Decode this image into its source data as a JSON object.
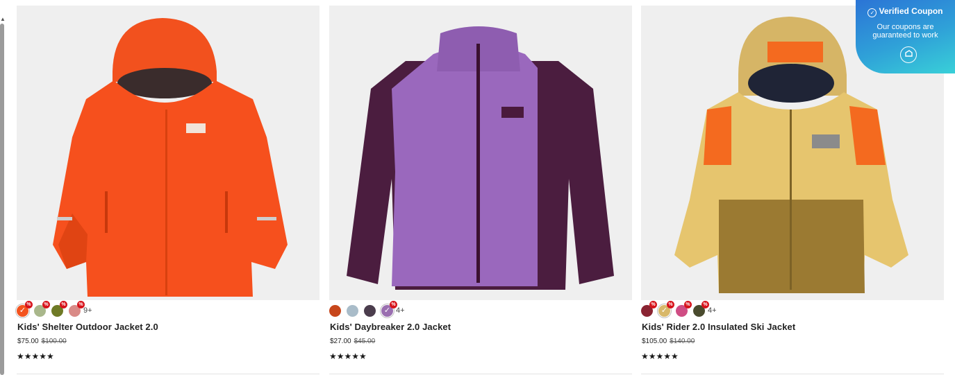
{
  "products": [
    {
      "name": "Kids' Shelter Outdoor Jacket 2.0",
      "price": "$75.00",
      "was_price": "$100.00",
      "rating": "★★★★★",
      "more_colors": "9+",
      "image_icon": "orange-rain-jacket-image",
      "swatches": [
        "#f3531e",
        "#a9b78b",
        "#6f7a26",
        "#d98a87"
      ],
      "swatch_sale": [
        true,
        true,
        true,
        true
      ]
    },
    {
      "name": "Kids' Daybreaker 2.0 Jacket",
      "price": "$27.00",
      "was_price": "$45.00",
      "rating": "★★★★★",
      "more_colors": "4+",
      "image_icon": "purple-fleece-jacket-image",
      "swatches": [
        "#c7461b",
        "#a9bcc9",
        "#4b3d4d",
        "#9a6fb0"
      ],
      "swatch_sale": [
        false,
        false,
        false,
        true
      ]
    },
    {
      "name": "Kids' Rider 2.0 Insulated Ski Jacket",
      "price": "$105.00",
      "was_price": "$140.00",
      "rating": "★★★★★",
      "more_colors": "4+",
      "image_icon": "yellow-ski-jacket-image",
      "swatches": [
        "#8a2432",
        "#d8b86a",
        "#cf4d84",
        "#4a4b2e"
      ],
      "swatch_sale": [
        true,
        true,
        true,
        true
      ]
    }
  ],
  "sale_badge": "%",
  "check_glyph": "✓",
  "coupon": {
    "title": "Verified Coupon",
    "line1": "Our coupons are",
    "line2": "guaranteed to work",
    "icon": "coupon-logo-icon"
  },
  "colors": {
    "coupon_start": "#2b74d6",
    "coupon_end": "#39d0d8",
    "sale_red": "#d7131b"
  }
}
